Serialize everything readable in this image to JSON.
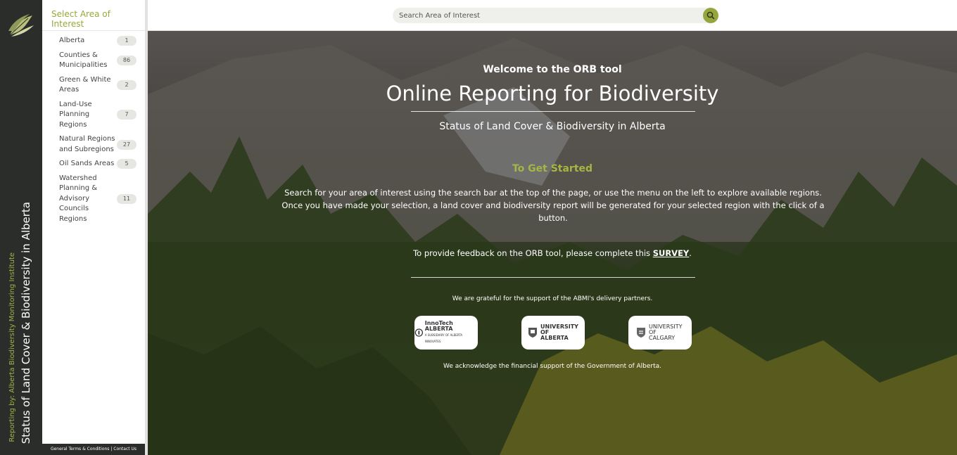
{
  "rail": {
    "reporting_by": "Reporting by: Alberta Biodiversity Monitoring Institute",
    "app_title": "Status of Land Cover & Biodiversity in Alberta"
  },
  "sidebar": {
    "header": "Select Area of Interest",
    "items": [
      {
        "label": "Alberta",
        "count": "1"
      },
      {
        "label": "Counties & Municipalities",
        "count": "86"
      },
      {
        "label": "Green & White Areas",
        "count": "2"
      },
      {
        "label": "Land-Use Planning Regions",
        "count": "7"
      },
      {
        "label": "Natural Regions and Subregions",
        "count": "27"
      },
      {
        "label": "Oil Sands Areas",
        "count": "5"
      },
      {
        "label": "Watershed Planning & Advisory Councils Regions",
        "count": "11"
      }
    ],
    "footer": "General Terms & Conditions | Contact Us"
  },
  "search": {
    "placeholder": "Search Area of Interest"
  },
  "hero": {
    "welcome": "Welcome to the ORB tool",
    "title": "Online Reporting for Biodiversity",
    "subtitle": "Status of Land Cover & Biodiversity in Alberta",
    "get_started": "To Get Started",
    "instructions": "Search for your area of interest using the search bar at the top of the page, or use the menu on the left to explore available regions. Once you have made your selection, a land cover and biodiversity report will be generated for your selected region with the click of a button.",
    "feedback_prefix": "To provide feedback on the ORB tool, please complete this ",
    "feedback_link": "SURVEY",
    "feedback_suffix": ".",
    "grateful": "We are grateful for the support of the ABMI's delivery partners.",
    "partners": [
      {
        "name": "InnoTech ALBERTA",
        "sub": "A SUBSIDIARY OF ALBERTA INNOVATES"
      },
      {
        "name": "UNIVERSITY OF ALBERTA"
      },
      {
        "name": "UNIVERSITY OF CALGARY"
      }
    ],
    "acknowledge": "We acknowledge the financial support of the Government of Alberta."
  },
  "colors": {
    "accent": "#98a83a",
    "rail": "#2b2d2a"
  }
}
